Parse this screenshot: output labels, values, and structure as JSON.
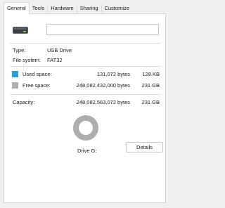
{
  "tabs": [
    {
      "label": "General",
      "active": true
    },
    {
      "label": "Tools",
      "active": false
    },
    {
      "label": "Hardware",
      "active": false
    },
    {
      "label": "Sharing",
      "active": false
    },
    {
      "label": "Customize",
      "active": false
    }
  ],
  "drive": {
    "icon": "usb-drive-icon",
    "name_value": ""
  },
  "info": {
    "type_label": "Type:",
    "type_value": "USB Drive",
    "fs_label": "File system:",
    "fs_value": "FAT32"
  },
  "space": {
    "used_label": "Used space:",
    "used_bytes": "131,072 bytes",
    "used_size": "128 KB",
    "used_color": "#26a0da",
    "free_label": "Free space:",
    "free_bytes": "248,082,432,000 bytes",
    "free_size": "231 GB",
    "free_color": "#aeaeae",
    "capacity_label": "Capacity:",
    "capacity_bytes": "248,082,563,072 bytes",
    "capacity_size": "231 GB",
    "used_fraction": 5e-07
  },
  "footer": {
    "drive_label": "Drive G:",
    "details_label": "Details"
  }
}
